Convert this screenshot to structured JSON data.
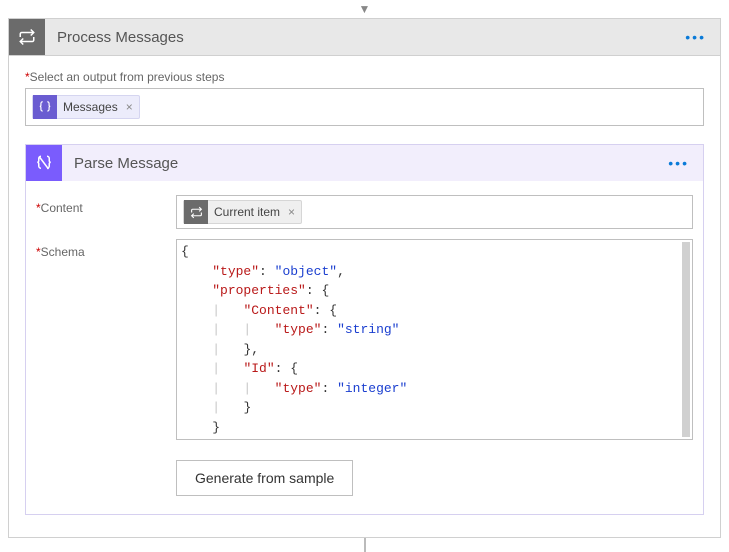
{
  "outer": {
    "title": "Process Messages",
    "output_label_prefix": "*",
    "output_label": "Select an output from previous steps",
    "token_label": "Messages"
  },
  "inner": {
    "title": "Parse Message",
    "content_label": "Content",
    "content_token": "Current item",
    "schema_label": "Schema",
    "generate_label": "Generate from sample"
  },
  "schema": {
    "k_type": "\"type\"",
    "k_properties": "\"properties\"",
    "k_content": "\"Content\"",
    "k_id": "\"Id\"",
    "v_object": "\"object\"",
    "v_string": "\"string\"",
    "v_integer": "\"integer\""
  }
}
